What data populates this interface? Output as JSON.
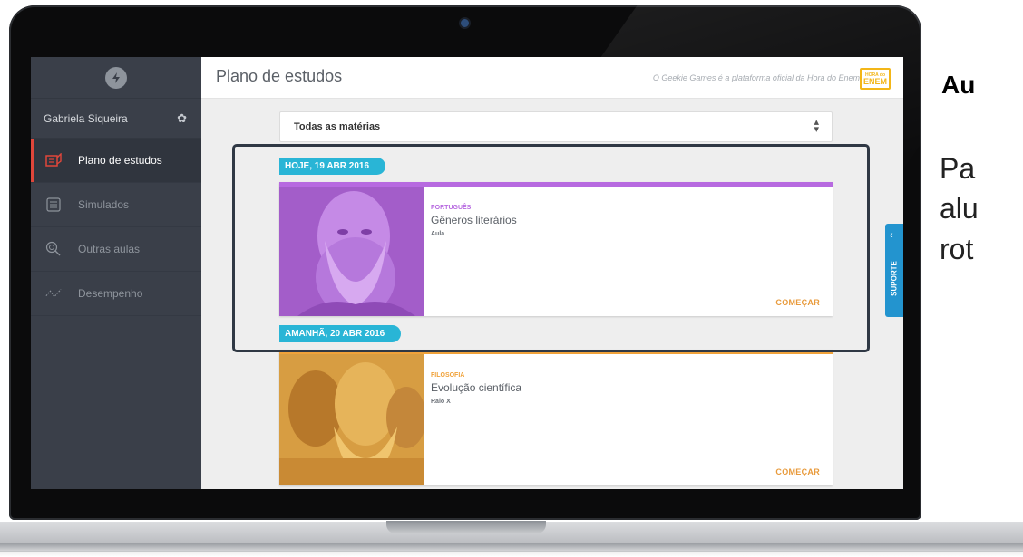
{
  "app": {
    "page_title": "Plano de estudos",
    "tagline": "O Geekie Games é a plataforma oficial da Hora do Enem",
    "badge": {
      "top": "HORA do",
      "bottom": "ENEM"
    }
  },
  "sidebar": {
    "user_name": "Gabriela Siqueira",
    "items": [
      {
        "label": "Plano de estudos",
        "icon": "study-plan-icon",
        "active": true
      },
      {
        "label": "Simulados",
        "icon": "list-icon",
        "active": false
      },
      {
        "label": "Outras aulas",
        "icon": "search-icon",
        "active": false
      },
      {
        "label": "Desempenho",
        "icon": "chart-line-icon",
        "active": false
      }
    ]
  },
  "filter": {
    "value": "Todas as matérias"
  },
  "days": [
    {
      "date_label": "HOJE, 19 ABR 2016",
      "card": {
        "subject": "Português",
        "title": "Gêneros literários",
        "kind": "Aula",
        "action": "COMEÇAR"
      }
    },
    {
      "date_label": "AMANHÃ, 20 ABR 2016",
      "card": {
        "subject": "Filosofia",
        "title": "Evolução científica",
        "kind": "Raio X",
        "action": "COMEÇAR"
      }
    }
  ],
  "support": {
    "label": "SUPORTE"
  },
  "side_text": {
    "heading": "Au",
    "lines": [
      "Pa",
      "alu",
      "rot"
    ]
  },
  "colors": {
    "portugues": "#b76ae0",
    "filosofia": "#f0a23a",
    "date_pill": "#29b5d6",
    "support": "#2394cf",
    "sidebar_bg": "#3a3f49",
    "active_marker": "#e0463a"
  }
}
